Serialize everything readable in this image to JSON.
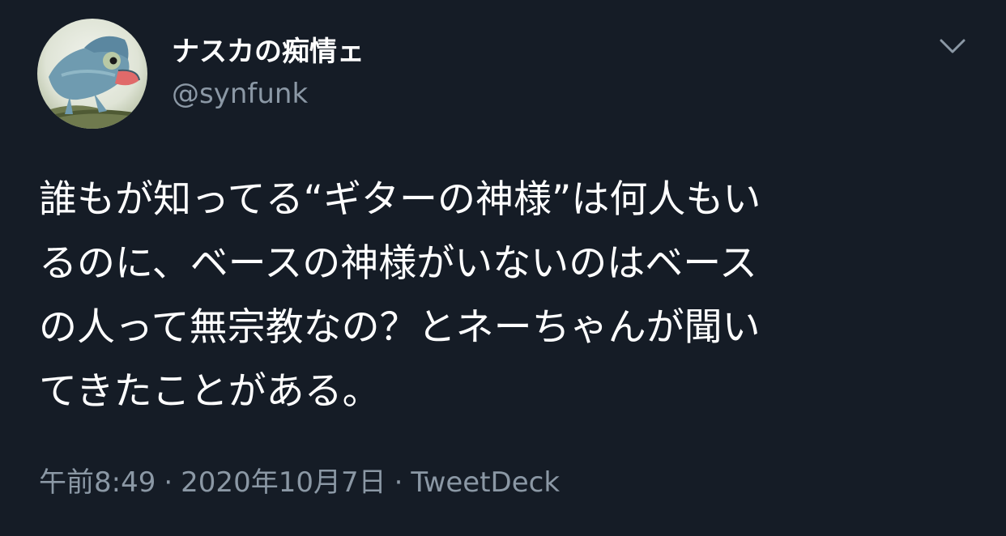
{
  "user": {
    "display_name": "ナスカの痴情ェ",
    "handle": "@synfunk",
    "avatar_icon": "chameleon-avatar"
  },
  "menu_icon": "chevron-down-icon",
  "tweet": {
    "lines": [
      "誰もが知ってる“ギターの神様”は何人もい",
      "るのに、ベースの神様がいないのはベース",
      "の人って無宗教なの？とネーちゃんが聞い",
      "てきたことがある。"
    ]
  },
  "meta": {
    "time": "午前8:49",
    "date": "2020年10月7日",
    "client": "TweetDeck",
    "separator": "·"
  },
  "colors": {
    "background": "#151c26",
    "text": "#ffffff",
    "secondary": "#8b98a5"
  }
}
